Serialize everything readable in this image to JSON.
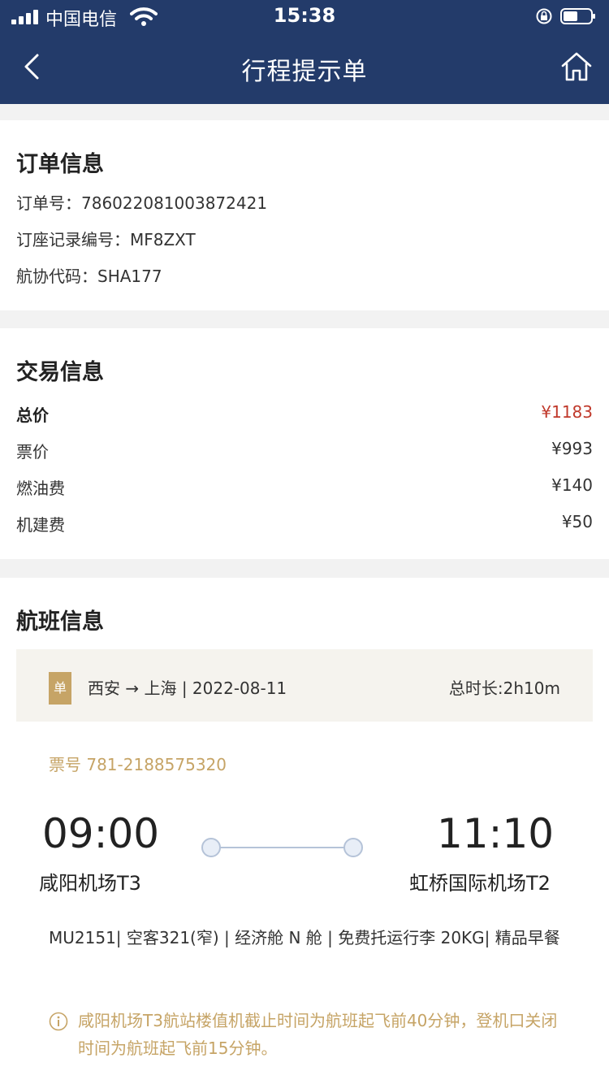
{
  "status_bar": {
    "carrier": "中国电信",
    "time": "15:38"
  },
  "nav": {
    "title": "行程提示单",
    "back_icon": "chevron-left-icon",
    "home_icon": "home-icon"
  },
  "order_info": {
    "title": "订单信息",
    "order_no_label": "订单号：",
    "order_no": "786022081003872421",
    "pnr_label": "订座记录编号：",
    "pnr": "MF8ZXT",
    "code_label": "航协代码：",
    "code": "SHA177"
  },
  "transaction": {
    "title": "交易信息",
    "items": [
      {
        "label": "总价",
        "amount": "¥1183"
      },
      {
        "label": "票价",
        "amount": "¥993"
      },
      {
        "label": "燃油费",
        "amount": "¥140"
      },
      {
        "label": "机建费",
        "amount": "¥50"
      }
    ]
  },
  "flight": {
    "title": "航班信息",
    "badge": "单",
    "route": "西安 → 上海 | 2022-08-11",
    "duration": "总时长:2h10m",
    "ticket_no": "票号 781-2188575320",
    "dep_time": "09:00",
    "dep_airport": "咸阳机场T3",
    "arr_time": "11:10",
    "arr_airport": "虹桥国际机场T2",
    "detail": "MU2151| 空客321(窄) | 经济舱 N 舱 | 免费托运行李 20KG| 精品早餐",
    "notice": "咸阳机场T3航站楼值机截止时间为航班起飞前40分钟，登机口关闭时间为航班起飞前15分钟。"
  },
  "colors": {
    "nav_bg": "#233b6a",
    "accent_gold": "#c6a466",
    "price_red": "#c0392b",
    "route_bg": "#f5f3ee"
  }
}
